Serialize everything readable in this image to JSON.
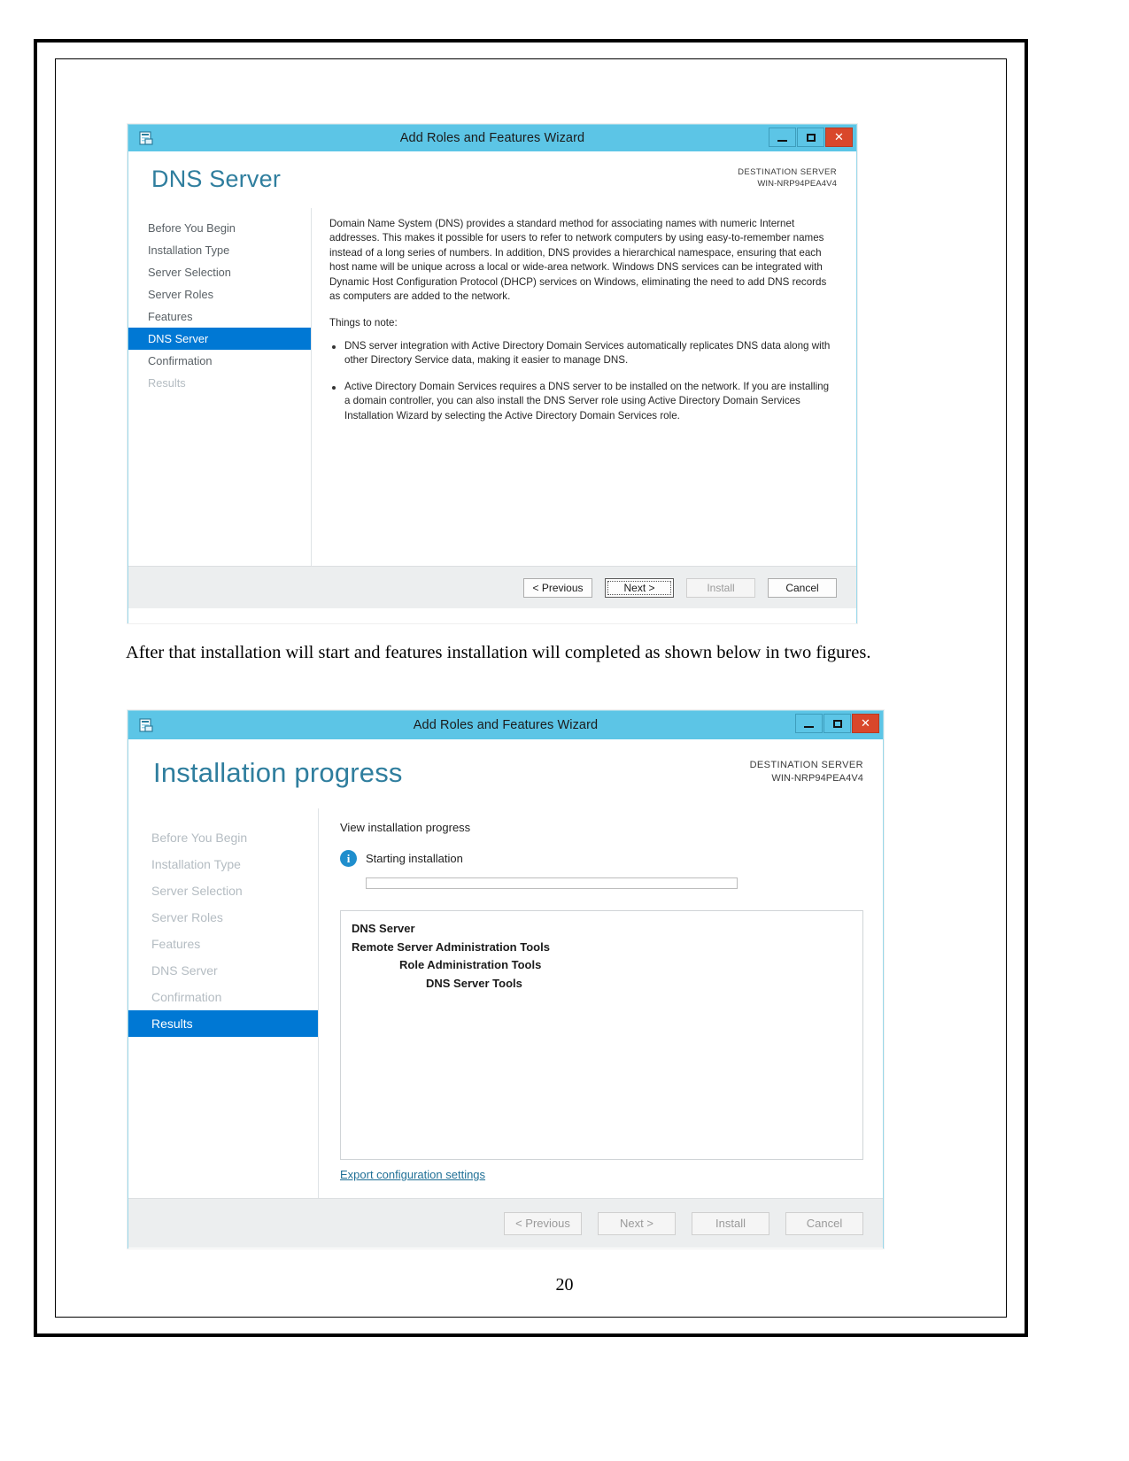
{
  "document": {
    "paragraph": "After that installation will start and features installation will completed as shown below in two figures.",
    "page_number": "20"
  },
  "dialog_dns": {
    "titlebar": {
      "title": "Add Roles and Features Wizard",
      "minimize_label": "–",
      "maximize_label": "□",
      "close_label": "✕"
    },
    "header": {
      "title": "DNS Server",
      "destination_label": "DESTINATION SERVER",
      "destination_server": "WIN-NRP94PEA4V4"
    },
    "nav": [
      {
        "label": "Before You Begin",
        "state": "normal"
      },
      {
        "label": "Installation Type",
        "state": "normal"
      },
      {
        "label": "Server Selection",
        "state": "normal"
      },
      {
        "label": "Server Roles",
        "state": "normal"
      },
      {
        "label": "Features",
        "state": "normal"
      },
      {
        "label": "DNS Server",
        "state": "active"
      },
      {
        "label": "Confirmation",
        "state": "normal"
      },
      {
        "label": "Results",
        "state": "dim"
      }
    ],
    "body": {
      "intro": "Domain Name System (DNS) provides a standard method for associating names with numeric Internet addresses. This makes it possible for users to refer to network computers by using easy-to-remember names instead of a long series of numbers. In addition, DNS provides a hierarchical namespace, ensuring that each host name will be unique across a local or wide-area network. Windows DNS services can be integrated with Dynamic Host Configuration Protocol (DHCP) services on Windows, eliminating the need to add DNS records as computers are added to the network.",
      "note_heading": "Things to note:",
      "bullets": [
        "DNS server integration with Active Directory Domain Services automatically replicates DNS data along with other Directory Service data, making it easier to manage DNS.",
        "Active Directory Domain Services requires a DNS server to be installed on the network. If you are installing a domain controller, you can also install the DNS Server role using Active Directory Domain Services Installation Wizard by selecting the Active Directory Domain Services role."
      ]
    },
    "buttons": {
      "previous": "< Previous",
      "next": "Next >",
      "install": "Install",
      "cancel": "Cancel"
    }
  },
  "dialog_progress": {
    "titlebar": {
      "title": "Add Roles and Features Wizard",
      "minimize_label": "–",
      "maximize_label": "□",
      "close_label": "✕"
    },
    "header": {
      "title": "Installation progress",
      "destination_label": "DESTINATION SERVER",
      "destination_server": "WIN-NRP94PEA4V4"
    },
    "nav": [
      {
        "label": "Before You Begin",
        "state": "dim"
      },
      {
        "label": "Installation Type",
        "state": "dim"
      },
      {
        "label": "Server Selection",
        "state": "dim"
      },
      {
        "label": "Server Roles",
        "state": "dim"
      },
      {
        "label": "Features",
        "state": "dim"
      },
      {
        "label": "DNS Server",
        "state": "dim"
      },
      {
        "label": "Confirmation",
        "state": "dim"
      },
      {
        "label": "Results",
        "state": "active"
      }
    ],
    "body": {
      "view_progress_label": "View installation progress",
      "status_text": "Starting installation",
      "progress_percent": 0,
      "features": [
        {
          "label": "DNS Server",
          "level": 1
        },
        {
          "label": "Remote Server Administration Tools",
          "level": 1
        },
        {
          "label": "Role Administration Tools",
          "level": 2
        },
        {
          "label": "DNS Server Tools",
          "level": 3
        }
      ],
      "export_link": "Export configuration settings"
    },
    "buttons": {
      "previous": "< Previous",
      "next": "Next >",
      "install": "Install",
      "cancel": "Cancel"
    }
  },
  "colors": {
    "titlebar": "#5cc5e6",
    "close_button": "#d9472b",
    "nav_active": "#0078d4",
    "header_title": "#2f7e9e",
    "link": "#1f6f96",
    "info_icon": "#1f8ecd"
  }
}
